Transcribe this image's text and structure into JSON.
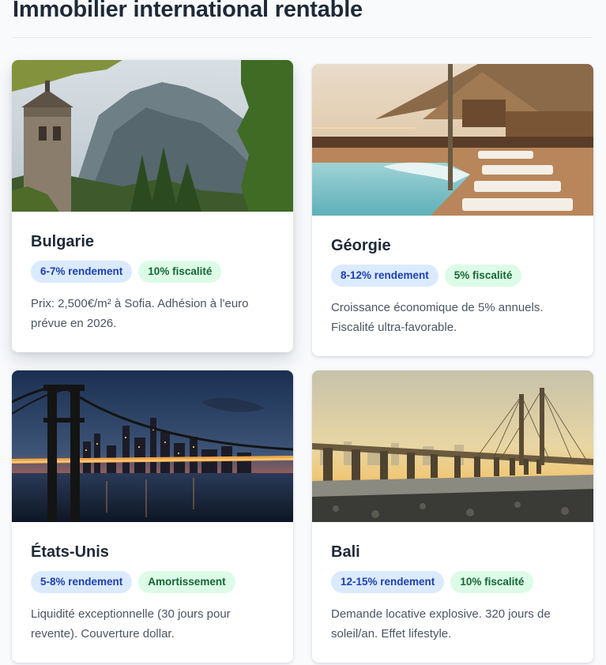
{
  "page": {
    "title": "Immobilier international rentable"
  },
  "cards": [
    {
      "title": "Bulgarie",
      "tag_yield": "6-7% rendement",
      "tag_tax": "10% fiscalité",
      "description": "Prix: 2,500€/m² à Sofia. Adhésion à l'euro prévue en 2026.",
      "image_icon": "mountain-tower-photo"
    },
    {
      "title": "Géorgie",
      "tag_yield": "8-12% rendement",
      "tag_tax": "5% fiscalité",
      "description": "Croissance économique de 5% annuels. Fiscalité ultra-favorable.",
      "image_icon": "resort-pool-photo"
    },
    {
      "title": "États-Unis",
      "tag_yield": "5-8% rendement",
      "tag_tax": "Amortissement",
      "description": "Liquidité exceptionnelle (30 jours pour revente). Couverture dollar.",
      "image_icon": "city-bridge-night-photo"
    },
    {
      "title": "Bali",
      "tag_yield": "12-15% rendement",
      "tag_tax": "10% fiscalité",
      "description": "Demande locative explosive. 320 jours de soleil/an. Effet lifestyle.",
      "image_icon": "sea-bridge-sunset-photo"
    }
  ],
  "colors": {
    "tag_blue_bg": "#dbeafe",
    "tag_blue_text": "#1e40af",
    "tag_green_bg": "#dcfce7",
    "tag_green_text": "#166534"
  }
}
